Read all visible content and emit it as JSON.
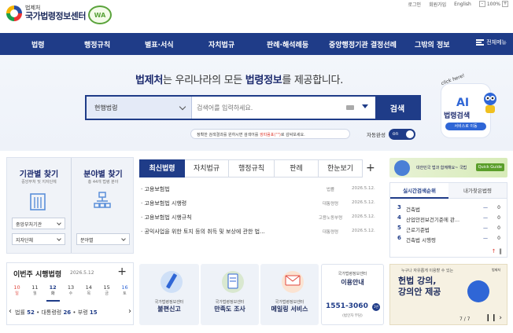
{
  "header": {
    "org_small": "법제처",
    "org_name": "국가법령정보센터",
    "wa_mark": "WA",
    "util": [
      "로그인",
      "회원가입",
      "English"
    ],
    "zoom_value": "100%",
    "zoom_minus": "-",
    "zoom_plus": "+"
  },
  "gnb": {
    "items": [
      "법령",
      "행정규칙",
      "별표·서식",
      "자치법규",
      "판례·해석례등",
      "중앙행정기관 결정선례",
      "그밖의 정보"
    ],
    "all_menu": "전체메뉴"
  },
  "hero": {
    "slogan_a": "법제처",
    "slogan_b": "는 우리나라의 모든 ",
    "slogan_c": "법령정보",
    "slogan_d": "를 제공합니다.",
    "search_category": "현행법령",
    "search_placeholder": "검색어를 입력하세요.",
    "search_button": "검색",
    "tip_a": "정확한 검색결과를 원하시면 검색어를 ",
    "tip_b": "쌍따옴표(\"\")",
    "tip_c": "로 감싸보세요.",
    "autocomplete_label": "자동완성",
    "autocomplete_state": "on"
  },
  "ai": {
    "click_text": "click here!",
    "title": "AI",
    "subtitle": "법령검색",
    "pill": "서비스로 이동"
  },
  "quick": {
    "agency_title": "기관별 찾기",
    "agency_sub": "중앙부처 및 지자단체",
    "agency_select1": "중앙부처기관",
    "agency_select2": "지자단체",
    "category_title": "분야별 찾기",
    "category_sub": "총 44개 법령 분야",
    "category_select": "분야별"
  },
  "tabs": {
    "items": [
      "최신법령",
      "자치법규",
      "행정규칙",
      "판례",
      "한눈보기"
    ],
    "plus": "+"
  },
  "laws": [
    {
      "title": "· 고용보험법",
      "type": "법률",
      "date": "2026.5.12."
    },
    {
      "title": "· 고용보험법 시행령",
      "type": "대통령령",
      "date": "2026.5.12."
    },
    {
      "title": "· 고용보험법 시행규칙",
      "type": "고용노동부령",
      "date": "2026.5.12."
    },
    {
      "title": "· 공익사업을 위한 토지 등의 취득 및 보상에 관한 법...",
      "type": "대통령령",
      "date": "2026.5.12."
    }
  ],
  "banner": {
    "text": "대한민국 법과 함께해요~ 국법",
    "guide": "Quick Guide"
  },
  "rank": {
    "tab_active": "실시간검색순위",
    "tab_other": "내가찾은법령",
    "rows": [
      {
        "num": "3",
        "name": "건축법",
        "dash": "—",
        "delta": "0"
      },
      {
        "num": "4",
        "name": "산업안전보건기준에 관...",
        "dash": "—",
        "delta": "0"
      },
      {
        "num": "5",
        "name": "근로기준법",
        "dash": "—",
        "delta": "0"
      },
      {
        "num": "6",
        "name": "건축법 시행령",
        "dash": "—",
        "delta": "0"
      }
    ],
    "up": "↑",
    "pause": "‖"
  },
  "weekly": {
    "title": "이번주 시행법령",
    "date": "2026.5.12",
    "plus": "+",
    "days": [
      {
        "d": "10",
        "w": "일"
      },
      {
        "d": "11",
        "w": "월"
      },
      {
        "d": "12",
        "w": "화"
      },
      {
        "d": "13",
        "w": "수"
      },
      {
        "d": "14",
        "w": "목"
      },
      {
        "d": "15",
        "w": "금"
      },
      {
        "d": "16",
        "w": "토"
      }
    ],
    "stats_a": "법률 ",
    "stats_a_n": "52",
    "stats_b": " • 대통령령 ",
    "stats_b_n": "26",
    "stats_c": " • 부령 ",
    "stats_c_n": "15",
    "prev": "‹",
    "next": "›"
  },
  "services": [
    {
      "org": "국가법령정보센터",
      "label": "불편신고"
    },
    {
      "org": "국가법령정보센터",
      "label": "만족도 조사"
    },
    {
      "org": "국가법령정보센터",
      "label": "메일링 서비스"
    }
  ],
  "phone": {
    "org": "국가법령정보센터",
    "label": "이용안내",
    "number": "1551-3060",
    "badge": "1번",
    "note": "(법인자 부담)"
  },
  "promo": {
    "small": "누구나 자유롭게 이용할 수 있는",
    "line1": "헌법 강의,",
    "line2": "강의안 제공",
    "page": "7 / 7",
    "ctl": "❙❙ ›",
    "org": "법제처"
  },
  "colors": {
    "brand": "#1f3c88",
    "accent_red": "#e0473d",
    "ai_blue": "#2f66d6"
  }
}
